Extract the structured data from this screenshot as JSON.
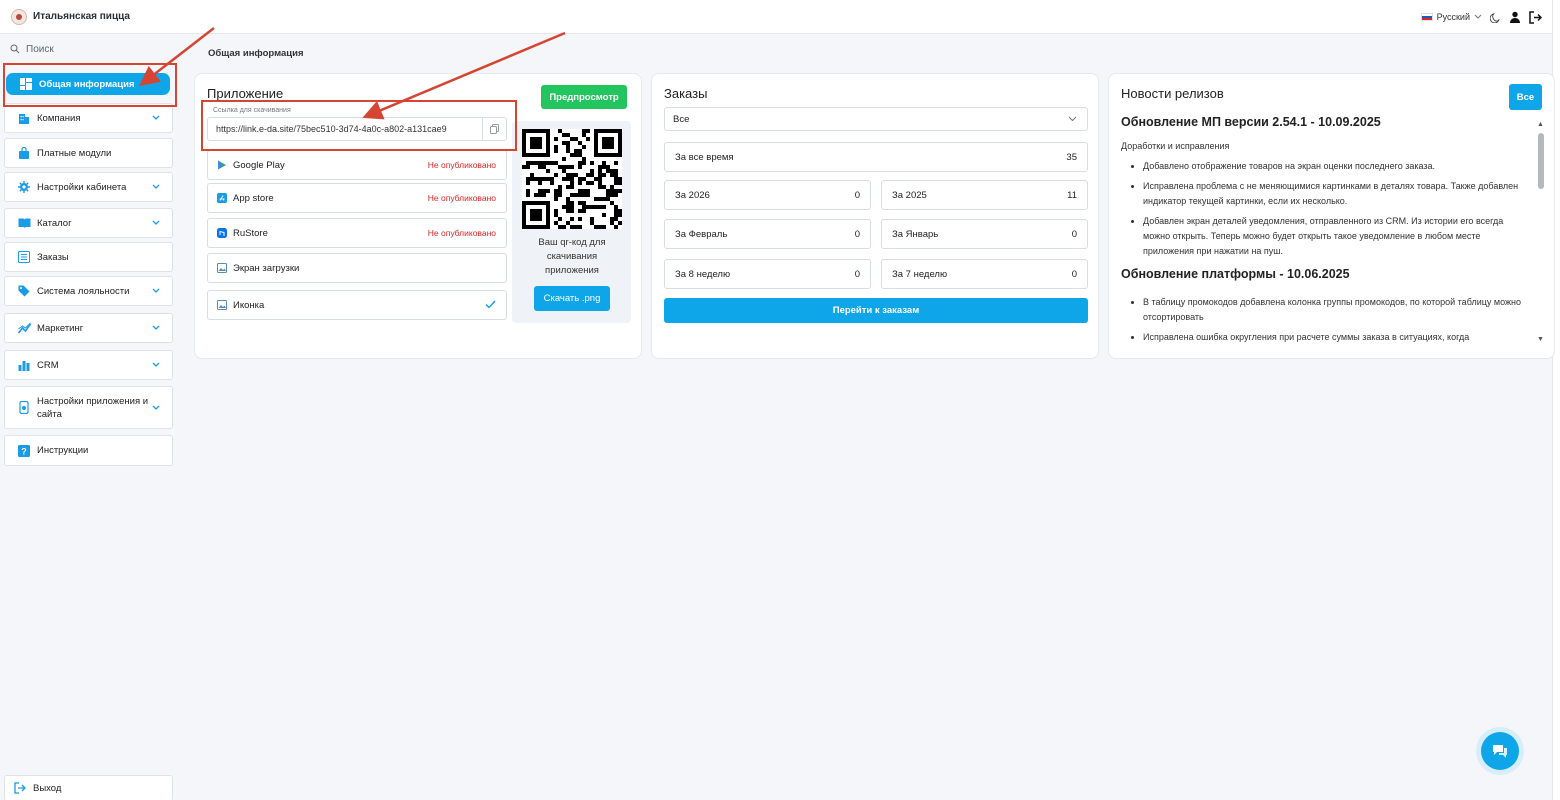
{
  "header": {
    "brand_name": "Итальянская пицца",
    "language": "Русский",
    "icons": [
      "language-flag-icon",
      "moon-icon",
      "user-icon",
      "logout-icon"
    ]
  },
  "sidebar": {
    "search_placeholder": "Поиск",
    "items": [
      {
        "label": "Общая информация",
        "icon": "dashboard-icon",
        "active": true
      },
      {
        "label": "Компания",
        "icon": "building-icon",
        "expandable": true
      },
      {
        "label": "Платные модули",
        "icon": "bag-icon"
      },
      {
        "label": "Настройки кабинета",
        "icon": "gear-icon",
        "expandable": true
      },
      {
        "label": "Каталог",
        "icon": "book-icon",
        "expandable": true
      },
      {
        "label": "Заказы",
        "icon": "list-icon"
      },
      {
        "label": "Система лояльности",
        "icon": "tag-icon",
        "expandable": true
      },
      {
        "label": "Маркетинг",
        "icon": "chart-icon",
        "expandable": true
      },
      {
        "label": "CRM",
        "icon": "bar-chart-icon",
        "expandable": true
      },
      {
        "label": "Настройки приложения и сайта",
        "icon": "phone-settings-icon",
        "expandable": true
      },
      {
        "label": "Инструкции",
        "icon": "question-icon"
      }
    ],
    "exit_label": "Выход"
  },
  "breadcrumb": "Общая информация",
  "app_card": {
    "title": "Приложение",
    "preview_button": "Предпросмотр",
    "link_label": "Ссылка для скачивания",
    "link_value": "https://link.e-da.site/75bec510-3d74-4a0c-a802-a131cae9",
    "stores": [
      {
        "name": "Google Play",
        "status": "Не опубликовано",
        "icon": "google-play-icon"
      },
      {
        "name": "App store",
        "status": "Не опубликовано",
        "icon": "app-store-icon"
      },
      {
        "name": "RuStore",
        "status": "Не опубликовано",
        "icon": "rustore-icon"
      },
      {
        "name": "Экран загрузки",
        "status": "",
        "icon": "image-icon"
      },
      {
        "name": "Иконка",
        "status": "done",
        "icon": "image-icon"
      }
    ],
    "qr_text": "Ваш qr-код для скачивания приложения",
    "download_button": "Скачать .png"
  },
  "orders_card": {
    "title": "Заказы",
    "filter_value": "Все",
    "total_label": "За все время",
    "total_value": "35",
    "stats": [
      {
        "label": "За 2026",
        "value": "0"
      },
      {
        "label": "За 2025",
        "value": "11"
      },
      {
        "label": "За Февраль",
        "value": "0"
      },
      {
        "label": "За Январь",
        "value": "0"
      },
      {
        "label": "За 8 неделю",
        "value": "0"
      },
      {
        "label": "За 7 неделю",
        "value": "0"
      }
    ],
    "go_button": "Перейти к заказам"
  },
  "news_card": {
    "title": "Новости релизов",
    "all_button": "Все",
    "release1_title": "Обновление МП версии 2.54.1 - 10.09.2025",
    "release1_sub": "Доработки и исправления",
    "release1_items": [
      "Добавлено отображение товаров на экран оценки последнего заказа.",
      "Исправлена проблема с не меняющимися картинками в деталях товара. Также добавлен индикатор текущей картинки, если их несколько.",
      "Добавлен экран деталей уведомления, отправленного из CRM. Из истории его всегда можно открыть. Теперь можно будет открыть такое уведомление в любом месте приложения при нажатии на пуш."
    ],
    "release2_title": "Обновление платформы - 10.06.2025",
    "release2_items": [
      "В таблицу промокодов добавлена колонка группы промокодов, по которой таблицу можно отсортировать",
      "Исправлена ошибка округления при расчете суммы заказа в ситуациях, когда"
    ]
  },
  "colors": {
    "accent": "#0ea5e9",
    "success": "#22c55e",
    "danger": "#dc2626",
    "annotation": "#d64534"
  }
}
